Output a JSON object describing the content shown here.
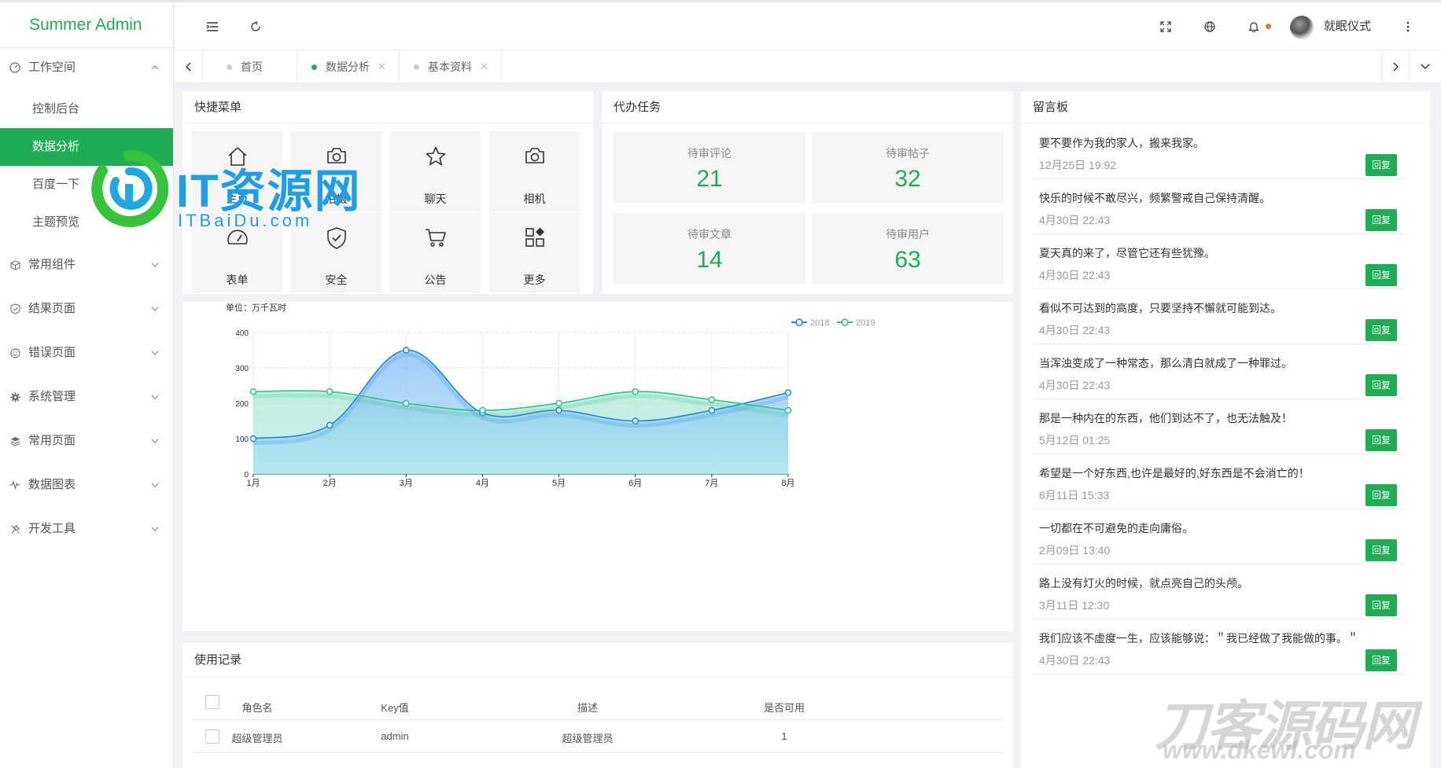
{
  "app": {
    "brand": "Summer Admin"
  },
  "sidebar": {
    "workspace": {
      "label": "工作空间",
      "items": [
        {
          "label": "控制后台"
        },
        {
          "label": "数据分析",
          "active": true
        },
        {
          "label": "百度一下"
        },
        {
          "label": "主题预览"
        }
      ]
    },
    "groups": [
      {
        "label": "常用组件",
        "icon": "cube-icon"
      },
      {
        "label": "结果页面",
        "icon": "shield-check-icon"
      },
      {
        "label": "错误页面",
        "icon": "smile-icon"
      },
      {
        "label": "系统管理",
        "icon": "gear-icon"
      },
      {
        "label": "常用页面",
        "icon": "layers-icon"
      },
      {
        "label": "数据图表",
        "icon": "pulse-icon"
      },
      {
        "label": "开发工具",
        "icon": "tools-icon"
      }
    ]
  },
  "header": {
    "username": "就眠仪式"
  },
  "tabs": [
    {
      "label": "首页",
      "active": false
    },
    {
      "label": "数据分析",
      "active": true
    },
    {
      "label": "基本资料",
      "active": false
    }
  ],
  "quick_menu": {
    "title": "快捷菜单",
    "items": [
      {
        "label": "主页",
        "icon": "home-icon"
      },
      {
        "label": "拍摄",
        "icon": "camera-icon"
      },
      {
        "label": "聊天",
        "icon": "star-icon"
      },
      {
        "label": "相机",
        "icon": "camera-icon"
      },
      {
        "label": "表单",
        "icon": "dashboard-icon"
      },
      {
        "label": "安全",
        "icon": "shield-icon"
      },
      {
        "label": "公告",
        "icon": "cart-icon"
      },
      {
        "label": "更多",
        "icon": "apps-icon"
      }
    ]
  },
  "tasks": {
    "title": "代办任务",
    "items": [
      {
        "label": "待审评论",
        "value": "21"
      },
      {
        "label": "待审帖子",
        "value": "32"
      },
      {
        "label": "待审文章",
        "value": "14"
      },
      {
        "label": "待审用户",
        "value": "63"
      }
    ]
  },
  "chart_data": {
    "type": "line",
    "categories": [
      "1月",
      "2月",
      "3月",
      "4月",
      "5月",
      "6月",
      "7月",
      "8月"
    ],
    "series": [
      {
        "name": "2018",
        "values": [
          100,
          138,
          350,
          173,
          180,
          150,
          180,
          230
        ],
        "color": "#1e88e5"
      },
      {
        "name": "2019",
        "values": [
          233,
          233,
          200,
          180,
          200,
          233,
          210,
          180
        ],
        "color": "#2ec48a"
      }
    ],
    "ylabel": "单位：万千瓦时",
    "ylim": [
      0,
      400
    ],
    "yticks": [
      "0",
      "100",
      "200",
      "300",
      "400"
    ],
    "smooth": true,
    "area": true,
    "legend": "top-right",
    "grid": true
  },
  "board": {
    "title": "留言板",
    "reply_label": "回复",
    "messages": [
      {
        "text": "要不要作为我的家人，搬来我家。",
        "date": "12月25日 19:92"
      },
      {
        "text": "快乐的时候不敢尽兴，频繁警戒自己保持清醒。",
        "date": "4月30日 22:43"
      },
      {
        "text": "夏天真的来了，尽管它还有些犹豫。",
        "date": "4月30日 22:43"
      },
      {
        "text": "看似不可达到的高度，只要坚持不懈就可能到达。",
        "date": "4月30日 22:43"
      },
      {
        "text": "当浑浊变成了一种常态，那么清白就成了一种罪过。",
        "date": "4月30日 22:43"
      },
      {
        "text": "那是一种内在的东西，他们到达不了，也无法触及！",
        "date": "5月12日 01:25"
      },
      {
        "text": "希望是一个好东西,也许是最好的,好东西是不会消亡的！",
        "date": "6月11日 15:33"
      },
      {
        "text": "一切都在不可避免的走向庸俗。",
        "date": "2月09日 13:40"
      },
      {
        "text": "路上没有灯火的时候，就点亮自己的头颅。",
        "date": "3月11日 12:30"
      },
      {
        "text": "我们应该不虚度一生，应该能够说：＂我已经做了我能做的事。＂",
        "date": "4月30日 22:43"
      }
    ]
  },
  "usage": {
    "title": "使用记录",
    "columns": [
      "角色名",
      "Key值",
      "描述",
      "是否可用"
    ],
    "rows": [
      {
        "name": "超级管理员",
        "key": "admin",
        "desc": "超级管理员",
        "enabled": "1"
      }
    ]
  },
  "watermarks": {
    "left_title": "IT资源网",
    "left_sub": "ITBaiDu.com",
    "right": "刀客源码网",
    "right_sub": "www.dkewl.com"
  }
}
